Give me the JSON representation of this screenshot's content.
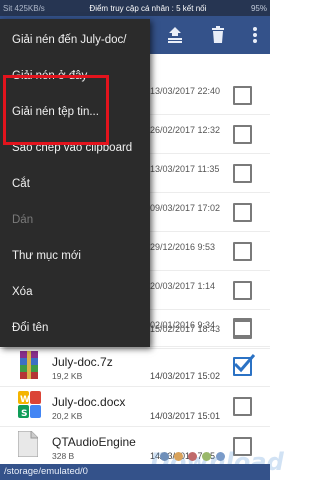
{
  "statusbar": {
    "left": "Sit 425KB/s",
    "notification": "Điểm truy cập cá nhân : 5 kết nối",
    "right": "95%"
  },
  "toolbar": {
    "icons": [
      "archive-upload-icon",
      "delete-icon",
      "more-vert-icon"
    ]
  },
  "files": {
    "rows": [
      {
        "date": "13/03/2017 22:40"
      },
      {
        "date": "26/02/2017 12:32"
      },
      {
        "date": "13/03/2017 11:35"
      },
      {
        "date": "09/03/2017 17:02"
      },
      {
        "date": "29/12/2016 9:53"
      },
      {
        "date": "20/03/2017 1:14"
      },
      {
        "date": "02/01/2016 9:34"
      },
      {
        "date": "15/02/2017 18:43"
      }
    ],
    "july7z": {
      "name": "July-doc.7z",
      "size": "19,2 KB",
      "date": "14/03/2017 15:02",
      "checked": true
    },
    "julydocx": {
      "name": "July-doc.docx",
      "size": "20,2 KB",
      "date": "14/03/2017 15:01",
      "checked": false
    },
    "qtaudio": {
      "name": "QTAudioEngine",
      "size": "328 B",
      "date": "14/03/2017 7:45",
      "checked": false
    }
  },
  "path": "/storage/emulated/0",
  "watermark": "Download",
  "menu": {
    "items": [
      {
        "label": "Giải nén đến July-doc/",
        "disabled": false
      },
      {
        "label": "Giải nén ở đây",
        "disabled": false
      },
      {
        "label": "Giải nén tệp tin...",
        "disabled": false
      },
      {
        "label": "Sao chép vào clipboard",
        "disabled": false
      },
      {
        "label": "Cắt",
        "disabled": false
      },
      {
        "label": "Dán",
        "disabled": true
      },
      {
        "label": "Thư mục mới",
        "disabled": false
      },
      {
        "label": "Xóa",
        "disabled": false
      },
      {
        "label": "Đổi tên",
        "disabled": false
      }
    ]
  },
  "colors": {
    "toolbar": "#34528a",
    "statusbar": "#263552",
    "menu_bg": "#2b2b2b",
    "highlight": "#e3141d",
    "check": "#2b72c4"
  }
}
